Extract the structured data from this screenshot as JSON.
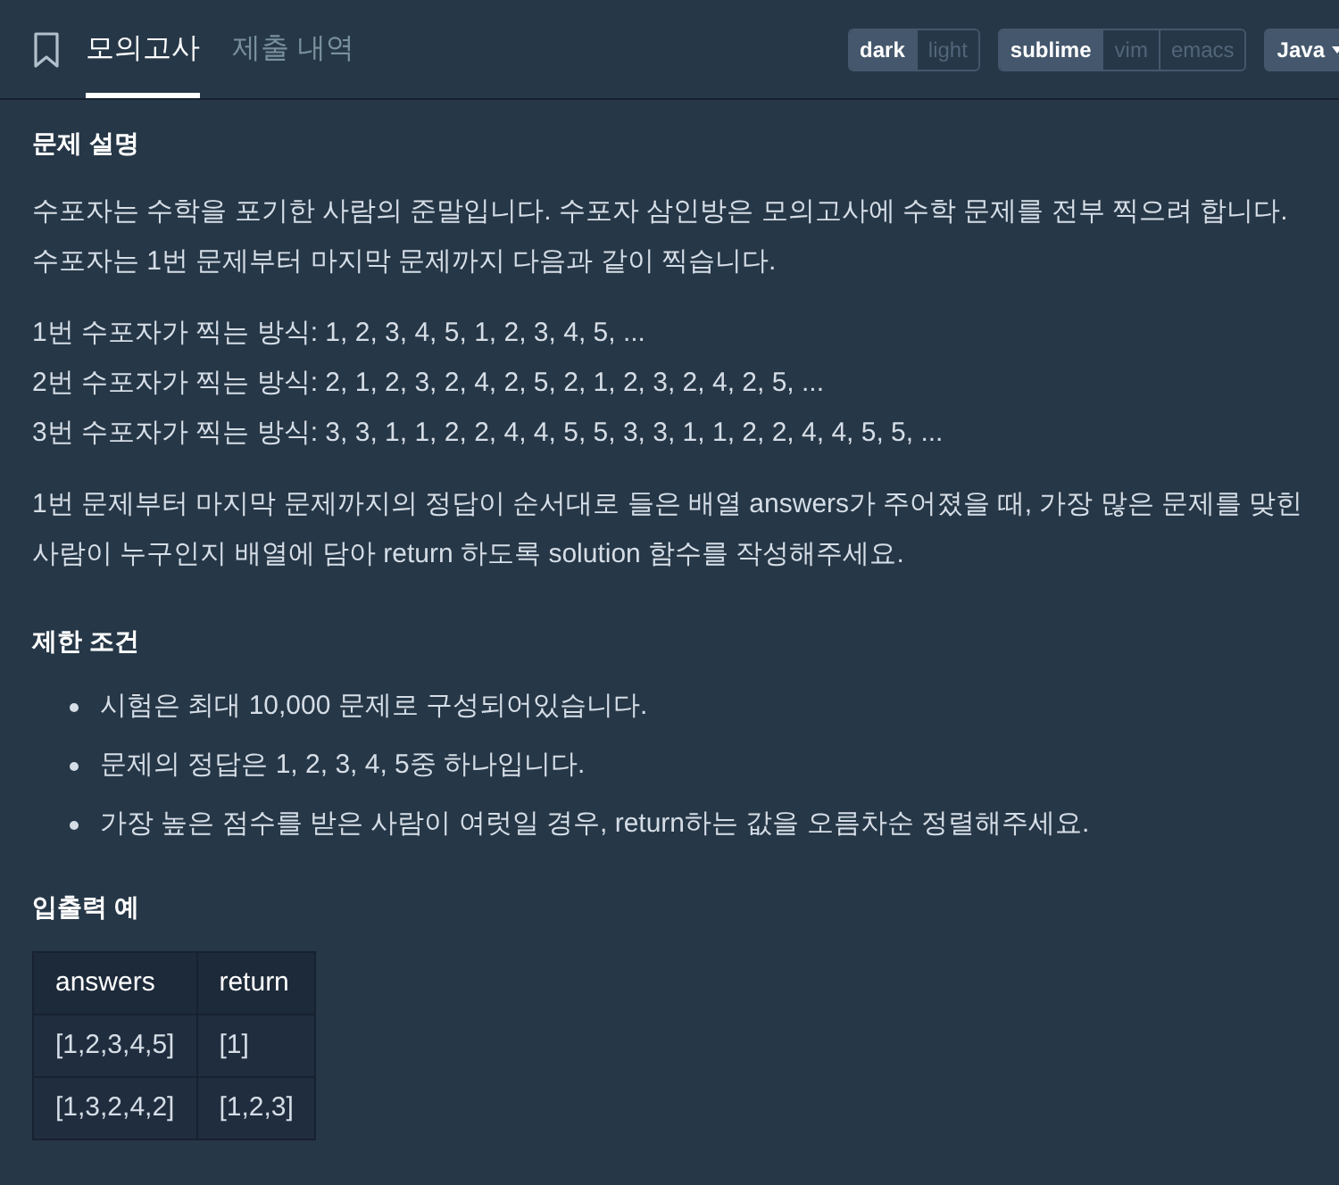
{
  "header": {
    "tabs": [
      {
        "label": "모의고사",
        "selected": true
      },
      {
        "label": "제출 내역",
        "selected": false
      }
    ],
    "toggle_groups": [
      [
        {
          "label": "dark",
          "selected": true
        },
        {
          "label": "light",
          "selected": false
        }
      ],
      [
        {
          "label": "sublime",
          "selected": true
        },
        {
          "label": "vim",
          "selected": false
        },
        {
          "label": "emacs",
          "selected": false
        }
      ]
    ],
    "language": "Java"
  },
  "sections": [
    {
      "kind": "text",
      "title": "문제 설명",
      "paragraphs": [
        [
          "수포자는 수학을 포기한 사람의 준말입니다. 수포자 삼인방은 모의고사에 수학 문제를 전부 찍으려 합니다. 수포자는 1번 문제부터 마지막 문제까지 다음과 같이 찍습니다."
        ],
        [
          "1번 수포자가 찍는 방식: 1, 2, 3, 4, 5, 1, 2, 3, 4, 5, ...",
          "2번 수포자가 찍는 방식: 2, 1, 2, 3, 2, 4, 2, 5, 2, 1, 2, 3, 2, 4, 2, 5, ...",
          "3번 수포자가 찍는 방식: 3, 3, 1, 1, 2, 2, 4, 4, 5, 5, 3, 3, 1, 1, 2, 2, 4, 4, 5, 5, ..."
        ],
        [
          "1번 문제부터 마지막 문제까지의 정답이 순서대로 들은 배열 answers가 주어졌을 때, 가장 많은 문제를 맞힌 사람이 누구인지 배열에 담아 return 하도록 solution 함수를 작성해주세요."
        ]
      ]
    },
    {
      "kind": "list",
      "title": "제한 조건",
      "items": [
        "시험은 최대 10,000 문제로 구성되어있습니다.",
        "문제의 정답은 1, 2, 3, 4, 5중 하나입니다.",
        "가장 높은 점수를 받은 사람이 여럿일 경우, return하는 값을 오름차순 정렬해주세요."
      ]
    },
    {
      "kind": "table",
      "title": "입출력 예",
      "columns": [
        "answers",
        "return"
      ],
      "rows": [
        [
          "[1,2,3,4,5]",
          "[1]"
        ],
        [
          "[1,3,2,4,2]",
          "[1,2,3]"
        ]
      ]
    }
  ]
}
